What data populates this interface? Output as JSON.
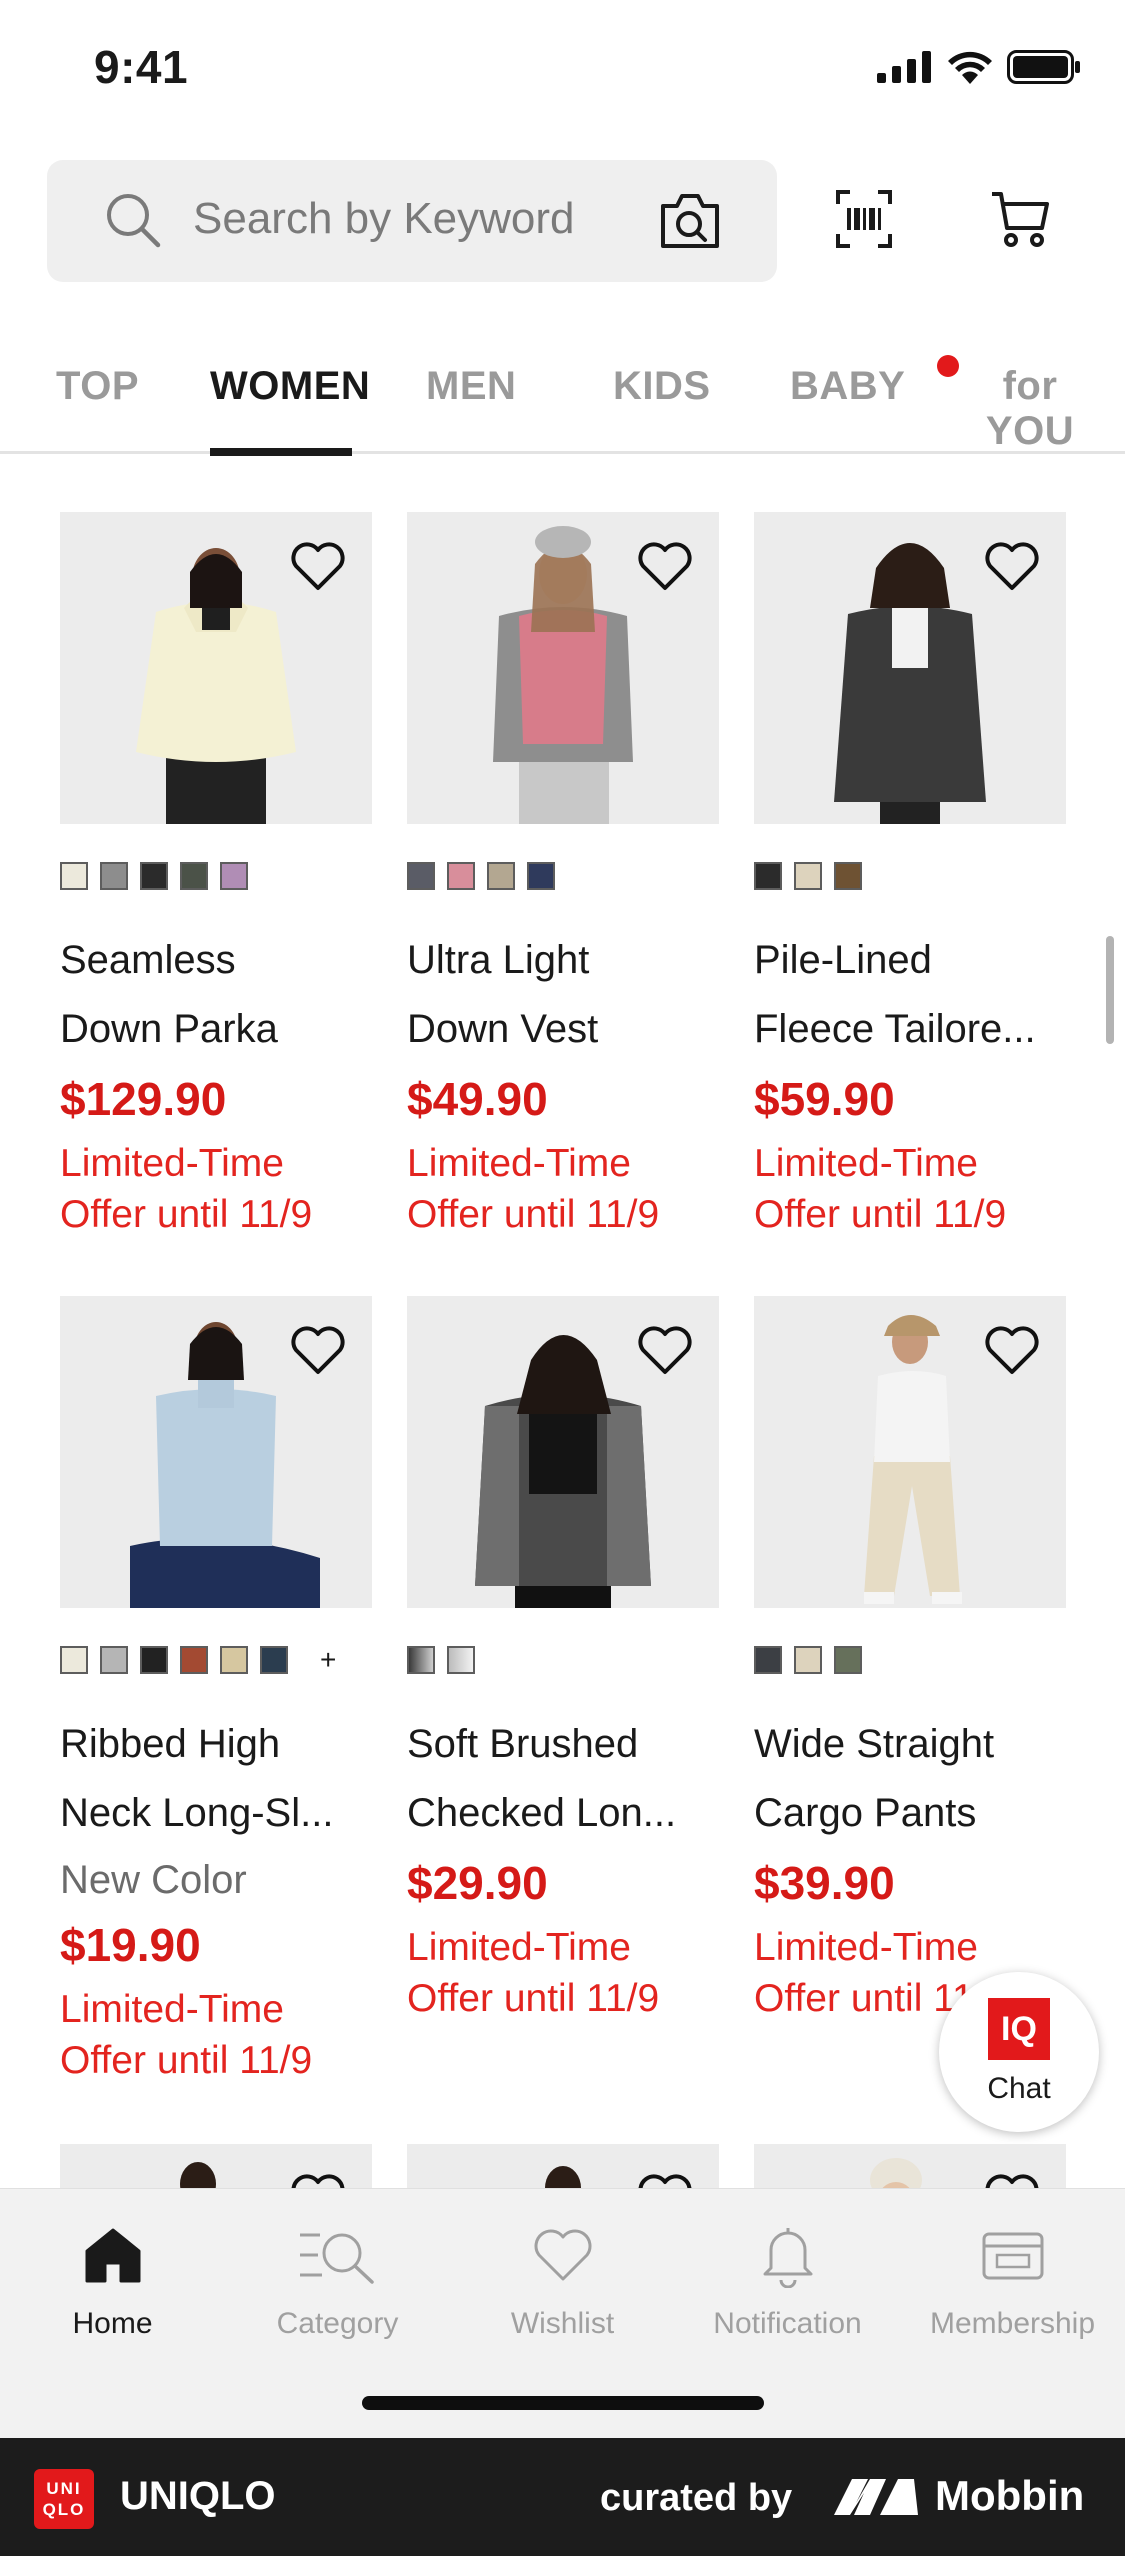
{
  "status_bar": {
    "time": "9:41"
  },
  "search": {
    "placeholder": "Search by Keyword"
  },
  "tabs": [
    {
      "label": "TOP",
      "active": false
    },
    {
      "label": "WOMEN",
      "active": true
    },
    {
      "label": "MEN",
      "active": false
    },
    {
      "label": "KIDS",
      "active": false
    },
    {
      "label": "BABY",
      "active": false
    },
    {
      "label": "for YOU",
      "active": false,
      "notification_dot": true
    }
  ],
  "products": [
    {
      "name_line1": "Seamless",
      "name_line2": "Down Parka",
      "price": "$129.90",
      "offer_line1": "Limited-Time",
      "offer_line2": "Offer until 11/9",
      "swatches": [
        "#ece9dc",
        "#8d8d8d",
        "#2b2b2b",
        "#4b5248",
        "#b08db5"
      ],
      "photo_bg": "#ececec",
      "garment_color": "#f4f1d4"
    },
    {
      "name_line1": "Ultra Light",
      "name_line2": "Down Vest",
      "price": "$49.90",
      "offer_line1": "Limited-Time",
      "offer_line2": "Offer until 11/9",
      "swatches": [
        "#5a5c66",
        "#d88e9b",
        "#b3a791",
        "#2f3a5c"
      ],
      "photo_bg": "#ececec",
      "garment_color": "#d77c8a"
    },
    {
      "name_line1": "Pile-Lined",
      "name_line2": "Fleece Tailore...",
      "price": "$59.90",
      "offer_line1": "Limited-Time",
      "offer_line2": "Offer until 11/9",
      "swatches": [
        "#2b2b2b",
        "#ddd3bd",
        "#6e5233"
      ],
      "photo_bg": "#ececec",
      "garment_color": "#3a3a3a"
    },
    {
      "name_line1": "Ribbed High",
      "name_line2": "Neck Long-Sl...",
      "new_color": "New Color",
      "price": "$19.90",
      "offer_line1": "Limited-Time",
      "offer_line2": "Offer until 11/9",
      "swatches": [
        "#ece9dc",
        "#b5b5b5",
        "#222222",
        "#a34a32",
        "#d6c7a0",
        "#2b3d4f"
      ],
      "more": "+",
      "photo_bg": "#ececec",
      "garment_color": "#b9cfe0"
    },
    {
      "name_line1": "Soft Brushed",
      "name_line2": "Checked Lon...",
      "price": "$29.90",
      "offer_line1": "Limited-Time",
      "offer_line2": "Offer until 11/9",
      "swatches": [
        "#3a3a3a",
        "#bcbcbc"
      ],
      "photo_bg": "#ececec",
      "garment_color": "#4a4a4a"
    },
    {
      "name_line1": "Wide Straight",
      "name_line2": "Cargo Pants",
      "price": "$39.90",
      "offer_line1": "Limited-Time",
      "offer_line2": "Offer until 11/9",
      "swatches": [
        "#3c3f44",
        "#ddd3bd",
        "#66705b"
      ],
      "photo_bg": "#ececec",
      "garment_color": "#e6dcc5"
    }
  ],
  "chat": {
    "badge": "IQ",
    "label": "Chat"
  },
  "bottom_nav": [
    {
      "label": "Home",
      "icon": "home-icon",
      "active": true
    },
    {
      "label": "Category",
      "icon": "category-search-icon",
      "active": false
    },
    {
      "label": "Wishlist",
      "icon": "heart-icon",
      "active": false
    },
    {
      "label": "Notification",
      "icon": "bell-icon",
      "active": false
    },
    {
      "label": "Membership",
      "icon": "membership-card-icon",
      "active": false
    }
  ],
  "footer": {
    "logo_line1": "UNI",
    "logo_line2": "QLO",
    "brand": "UNIQLO",
    "curated_by": "curated by",
    "mobbin": "Mobbin"
  },
  "colors": {
    "accent_red": "#d51a17",
    "brand_red": "#e2191b"
  }
}
